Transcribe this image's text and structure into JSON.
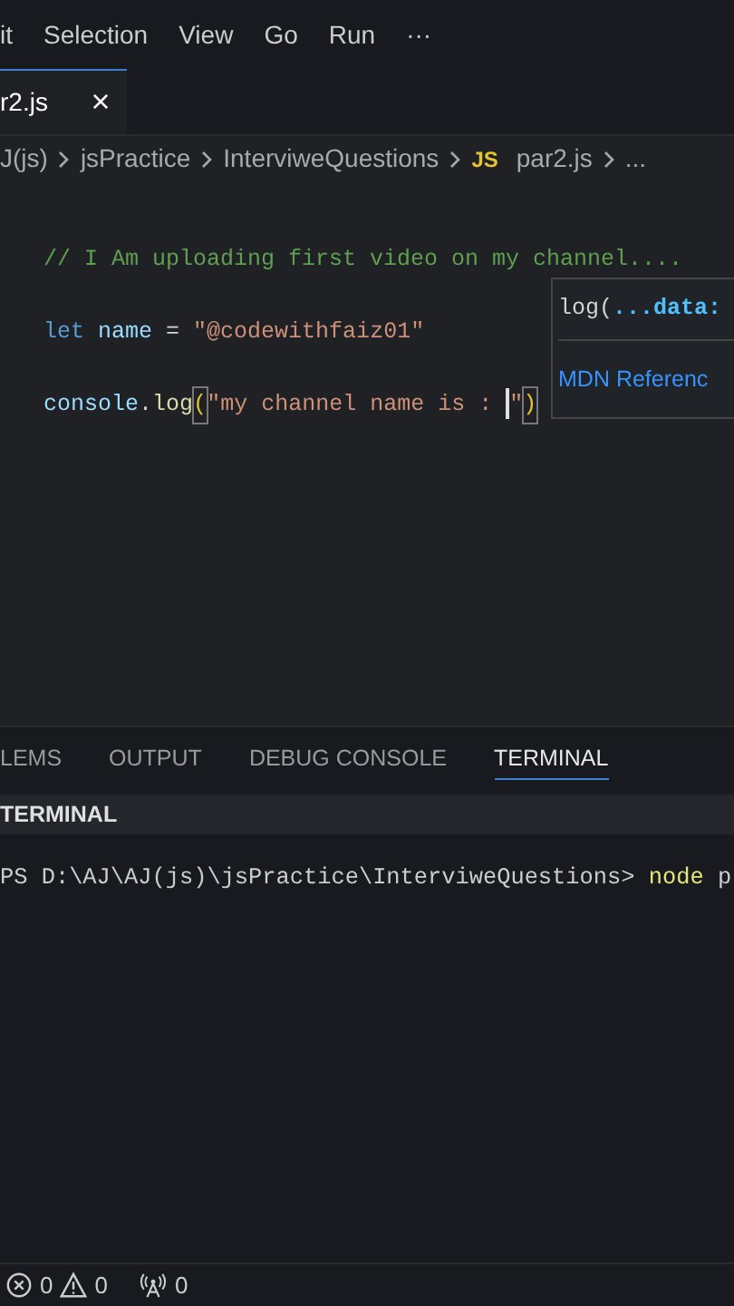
{
  "menu_bar": {
    "items": [
      "it",
      "Selection",
      "View",
      "Go",
      "Run",
      "···"
    ]
  },
  "tabs": [
    {
      "label": "r2.js",
      "selected": true,
      "close": "×"
    }
  ],
  "breadcrumb": {
    "segments": [
      {
        "label": "J(js)"
      },
      {
        "label": "jsPractice"
      },
      {
        "label": "InterviweQuestions"
      },
      {
        "label": "par2.js",
        "icon_text": "JS"
      },
      {
        "label": "..."
      }
    ]
  },
  "editor": {
    "lines": [
      [
        {
          "text": "// I Am uploading first video on my channel....",
          "kind": "comment"
        }
      ],
      [
        {
          "text": "let ",
          "kind": "keyword"
        },
        {
          "text": "name",
          "kind": "variable"
        },
        {
          "text": " = ",
          "kind": "plain"
        },
        {
          "text": "\"@codewithfaiz01\"",
          "kind": "string"
        }
      ],
      [
        {
          "text": "console",
          "kind": "variable"
        },
        {
          "text": ".",
          "kind": "plain"
        },
        {
          "text": "log",
          "kind": "function"
        },
        {
          "text": "(",
          "kind": "bracket"
        },
        {
          "text": "\"my channel name is : ",
          "kind": "string",
          "cursor_after": true
        },
        {
          "text": "\"",
          "kind": "string"
        },
        {
          "text": ")",
          "kind": "bracket"
        }
      ]
    ],
    "hover": {
      "signature": [
        {
          "text": "log(",
          "kind": "plain"
        },
        {
          "text": "...data:",
          "kind": "param"
        }
      ],
      "link": "MDN Referenc"
    }
  },
  "panel": {
    "tabs": [
      {
        "label": "LEMS",
        "selected": false
      },
      {
        "label": "OUTPUT",
        "selected": false
      },
      {
        "label": "DEBUG CONSOLE",
        "selected": false
      },
      {
        "label": "TERMINAL",
        "selected": true
      }
    ],
    "header": "TERMINAL",
    "terminal_line": [
      {
        "text": "PS D:\\AJ\\AJ(js)\\jsPractice\\InterviweQuestions> ",
        "kind": "prompt"
      },
      {
        "text": "node",
        "kind": "command"
      },
      {
        "text": " p",
        "kind": "prompt"
      }
    ]
  },
  "status_bar": {
    "items": [
      {
        "kind": "error",
        "text": "0"
      },
      {
        "kind": "warning",
        "text": "0"
      },
      {
        "kind": "ports",
        "text": "0"
      }
    ]
  }
}
